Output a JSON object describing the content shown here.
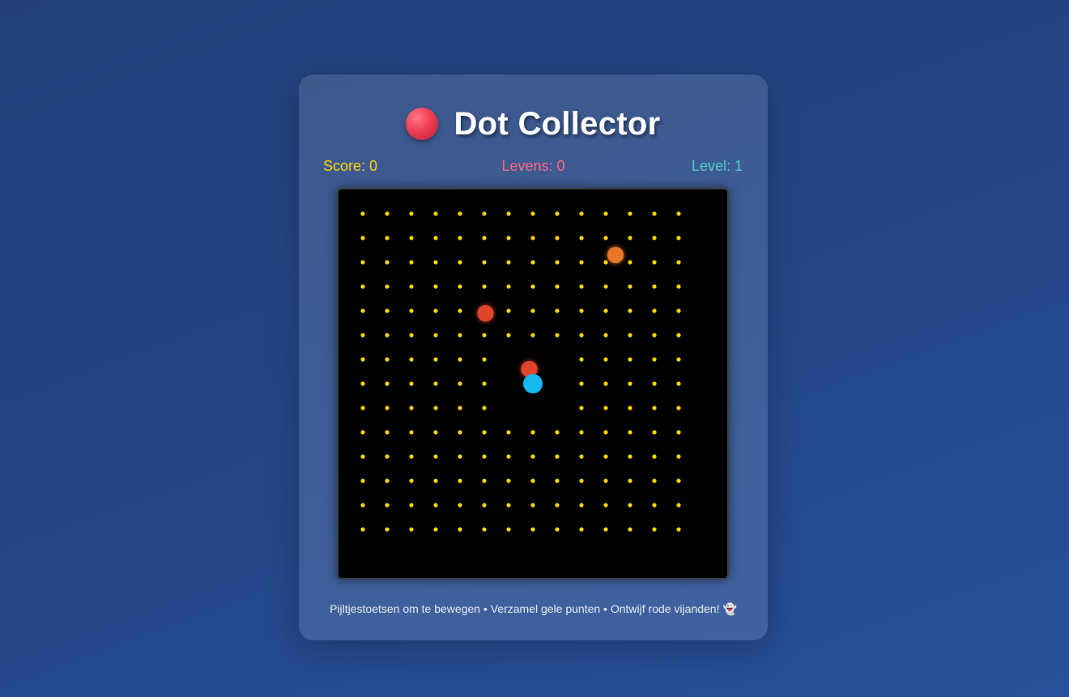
{
  "game": {
    "title": "Dot Collector",
    "logo_icon": "red-ball-icon"
  },
  "stats": {
    "score": "Score: 0",
    "lives": "Levens: 0",
    "level": "Level: 1"
  },
  "instructions": {
    "text": "Pijltjestoetsen om te bewegen • Verzamel gele punten • Ontwijf rode vijanden!",
    "icon": "ghost-icon",
    "icon_glyph": "👻"
  },
  "colors": {
    "score": "#ffd700",
    "lives": "#ff6b7d",
    "level": "#4ecdc4",
    "dot": "#ffd700",
    "player": "#17b8f0",
    "enemy_red": "#e0452a",
    "enemy_orange": "#e8772a",
    "board": "#000000"
  },
  "board": {
    "columns": 16,
    "rows": 16,
    "dots": [
      [
        1,
        1
      ],
      [
        2,
        1
      ],
      [
        3,
        1
      ],
      [
        4,
        1
      ],
      [
        5,
        1
      ],
      [
        6,
        1
      ],
      [
        7,
        1
      ],
      [
        8,
        1
      ],
      [
        9,
        1
      ],
      [
        10,
        1
      ],
      [
        11,
        1
      ],
      [
        12,
        1
      ],
      [
        13,
        1
      ],
      [
        14,
        1
      ],
      [
        1,
        2
      ],
      [
        2,
        2
      ],
      [
        3,
        2
      ],
      [
        4,
        2
      ],
      [
        5,
        2
      ],
      [
        6,
        2
      ],
      [
        7,
        2
      ],
      [
        8,
        2
      ],
      [
        9,
        2
      ],
      [
        10,
        2
      ],
      [
        11,
        2
      ],
      [
        12,
        2
      ],
      [
        13,
        2
      ],
      [
        14,
        2
      ],
      [
        1,
        3
      ],
      [
        2,
        3
      ],
      [
        3,
        3
      ],
      [
        4,
        3
      ],
      [
        5,
        3
      ],
      [
        6,
        3
      ],
      [
        7,
        3
      ],
      [
        8,
        3
      ],
      [
        9,
        3
      ],
      [
        10,
        3
      ],
      [
        11,
        3
      ],
      [
        12,
        3
      ],
      [
        13,
        3
      ],
      [
        14,
        3
      ],
      [
        1,
        4
      ],
      [
        2,
        4
      ],
      [
        3,
        4
      ],
      [
        4,
        4
      ],
      [
        5,
        4
      ],
      [
        6,
        4
      ],
      [
        7,
        4
      ],
      [
        8,
        4
      ],
      [
        9,
        4
      ],
      [
        10,
        4
      ],
      [
        11,
        4
      ],
      [
        12,
        4
      ],
      [
        13,
        4
      ],
      [
        14,
        4
      ],
      [
        1,
        5
      ],
      [
        2,
        5
      ],
      [
        3,
        5
      ],
      [
        4,
        5
      ],
      [
        5,
        5
      ],
      [
        6,
        5
      ],
      [
        7,
        5
      ],
      [
        8,
        5
      ],
      [
        9,
        5
      ],
      [
        10,
        5
      ],
      [
        11,
        5
      ],
      [
        12,
        5
      ],
      [
        13,
        5
      ],
      [
        14,
        5
      ],
      [
        1,
        6
      ],
      [
        2,
        6
      ],
      [
        3,
        6
      ],
      [
        4,
        6
      ],
      [
        5,
        6
      ],
      [
        6,
        6
      ],
      [
        7,
        6
      ],
      [
        8,
        6
      ],
      [
        9,
        6
      ],
      [
        10,
        6
      ],
      [
        11,
        6
      ],
      [
        12,
        6
      ],
      [
        13,
        6
      ],
      [
        14,
        6
      ],
      [
        1,
        7
      ],
      [
        2,
        7
      ],
      [
        3,
        7
      ],
      [
        4,
        7
      ],
      [
        5,
        7
      ],
      [
        6,
        7
      ],
      [
        10,
        7
      ],
      [
        11,
        7
      ],
      [
        12,
        7
      ],
      [
        13,
        7
      ],
      [
        14,
        7
      ],
      [
        1,
        8
      ],
      [
        2,
        8
      ],
      [
        3,
        8
      ],
      [
        4,
        8
      ],
      [
        5,
        8
      ],
      [
        6,
        8
      ],
      [
        10,
        8
      ],
      [
        11,
        8
      ],
      [
        12,
        8
      ],
      [
        13,
        8
      ],
      [
        14,
        8
      ],
      [
        1,
        9
      ],
      [
        2,
        9
      ],
      [
        3,
        9
      ],
      [
        4,
        9
      ],
      [
        5,
        9
      ],
      [
        6,
        9
      ],
      [
        10,
        9
      ],
      [
        11,
        9
      ],
      [
        12,
        9
      ],
      [
        13,
        9
      ],
      [
        14,
        9
      ],
      [
        1,
        10
      ],
      [
        2,
        10
      ],
      [
        3,
        10
      ],
      [
        4,
        10
      ],
      [
        5,
        10
      ],
      [
        6,
        10
      ],
      [
        7,
        10
      ],
      [
        8,
        10
      ],
      [
        9,
        10
      ],
      [
        10,
        10
      ],
      [
        11,
        10
      ],
      [
        12,
        10
      ],
      [
        13,
        10
      ],
      [
        14,
        10
      ],
      [
        1,
        11
      ],
      [
        2,
        11
      ],
      [
        3,
        11
      ],
      [
        4,
        11
      ],
      [
        5,
        11
      ],
      [
        6,
        11
      ],
      [
        7,
        11
      ],
      [
        8,
        11
      ],
      [
        9,
        11
      ],
      [
        10,
        11
      ],
      [
        11,
        11
      ],
      [
        12,
        11
      ],
      [
        13,
        11
      ],
      [
        14,
        11
      ],
      [
        1,
        12
      ],
      [
        2,
        12
      ],
      [
        3,
        12
      ],
      [
        4,
        12
      ],
      [
        5,
        12
      ],
      [
        6,
        12
      ],
      [
        7,
        12
      ],
      [
        8,
        12
      ],
      [
        9,
        12
      ],
      [
        10,
        12
      ],
      [
        11,
        12
      ],
      [
        12,
        12
      ],
      [
        13,
        12
      ],
      [
        14,
        12
      ],
      [
        1,
        13
      ],
      [
        2,
        13
      ],
      [
        3,
        13
      ],
      [
        4,
        13
      ],
      [
        5,
        13
      ],
      [
        6,
        13
      ],
      [
        7,
        13
      ],
      [
        8,
        13
      ],
      [
        9,
        13
      ],
      [
        10,
        13
      ],
      [
        11,
        13
      ],
      [
        12,
        13
      ],
      [
        13,
        13
      ],
      [
        14,
        13
      ],
      [
        1,
        14
      ],
      [
        2,
        14
      ],
      [
        3,
        14
      ],
      [
        4,
        14
      ],
      [
        5,
        14
      ],
      [
        6,
        14
      ],
      [
        7,
        14
      ],
      [
        8,
        14
      ],
      [
        9,
        14
      ],
      [
        10,
        14
      ],
      [
        11,
        14
      ],
      [
        12,
        14
      ],
      [
        13,
        14
      ],
      [
        14,
        14
      ]
    ],
    "player": {
      "cell": [
        8,
        8
      ],
      "name": "player"
    },
    "enemies": [
      {
        "name": "enemy-orange",
        "cell": [
          11.4,
          2.7
        ],
        "color_key": "enemy_orange"
      },
      {
        "name": "enemy-red-1",
        "cell": [
          6.05,
          5.1
        ],
        "color_key": "enemy_red"
      },
      {
        "name": "enemy-red-2",
        "cell": [
          7.85,
          7.4
        ],
        "color_key": "enemy_red"
      }
    ]
  }
}
